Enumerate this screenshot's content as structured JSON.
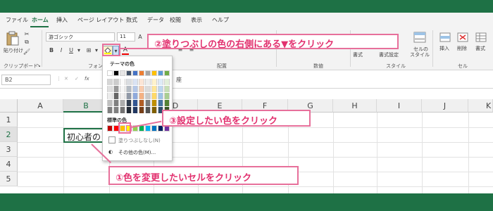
{
  "menu": {
    "items": [
      "ファイル",
      "ホーム",
      "挿入",
      "ページ レイアウト",
      "数式",
      "データ",
      "校閲",
      "表示",
      "ヘルプ"
    ],
    "active": "ホーム"
  },
  "ribbon": {
    "clipboard": {
      "paste": "貼り付け",
      "label": "クリップボード"
    },
    "font": {
      "font_name": "游ゴシック",
      "font_size": "11",
      "label": "フォント",
      "bold": "B",
      "italic": "I",
      "underline": "U",
      "font_color_glyph": "A"
    },
    "alignment": {
      "label": "配置"
    },
    "number": {
      "label": "数値"
    },
    "styles": {
      "format_table": "書式",
      "cell_style_line1": "セルの",
      "cell_style_line2": "スタイル",
      "format_table_suffix": "書式設定",
      "label": "スタイル"
    },
    "cells": {
      "insert": "挿入",
      "delete": "削除",
      "format": "書式",
      "label": "セル"
    }
  },
  "formula_bar": {
    "name_box": "B2",
    "fx": "fx",
    "content": "初心者の",
    "trailing_text": "座"
  },
  "sheet": {
    "columns": [
      "A",
      "B",
      "C",
      "D",
      "E",
      "F",
      "G",
      "H",
      "I",
      "J",
      "K"
    ],
    "rows": [
      "1",
      "2",
      "3",
      "4",
      "5"
    ],
    "selected_column": "B",
    "selected_row": "2",
    "b2_value": "初心者の"
  },
  "palette": {
    "theme_label": "テーマの色",
    "standard_label": "標準の色",
    "no_fill": "塗りつぶしなし(N)",
    "more_colors": "その他の色(M)...",
    "theme_colors": [
      "#ffffff",
      "#000000",
      "#e7e6e6",
      "#44546a",
      "#4472c4",
      "#ed7d31",
      "#a5a5a5",
      "#ffc000",
      "#5b9bd5",
      "#70ad47"
    ],
    "standard_colors": [
      "#c00000",
      "#ff0000",
      "#ffc000",
      "#ffff00",
      "#92d050",
      "#00b050",
      "#00b0f0",
      "#0070c0",
      "#002060",
      "#7030a0"
    ],
    "selected_standard": "#ffff00"
  },
  "callouts": {
    "step1": "①色を変更したいセルをクリック",
    "step2": "②塗りつぶしの色の右側にある▼をクリック",
    "step3": "③設定したい色をクリック"
  },
  "colors": {
    "excel_green": "#1e7145",
    "callout_pink": "#e7709b",
    "callout_text": "#e2316f"
  }
}
